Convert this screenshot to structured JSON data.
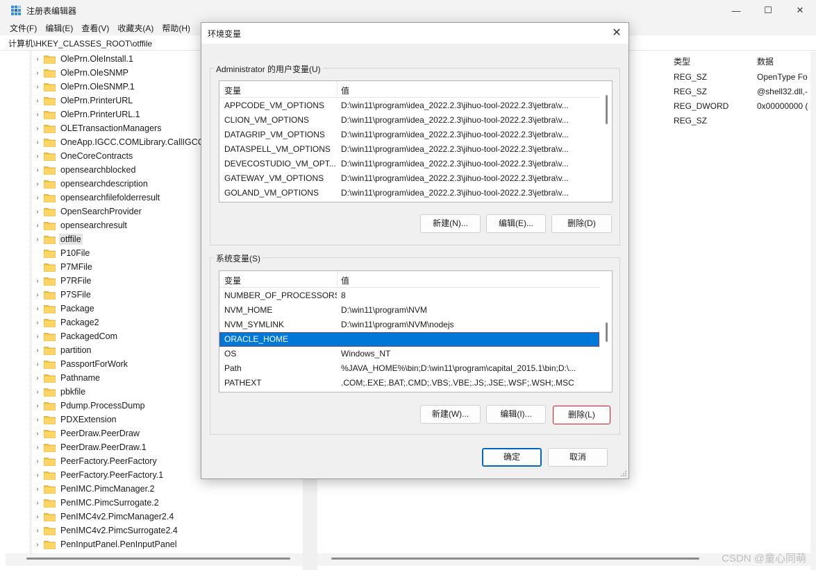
{
  "app": {
    "title": "注册表编辑器",
    "controls": {
      "minimize": "—",
      "maximize": "☐",
      "close": "✕"
    }
  },
  "menu": [
    "文件(F)",
    "编辑(E)",
    "查看(V)",
    "收藏夹(A)",
    "帮助(H)"
  ],
  "address": "计算机\\HKEY_CLASSES_ROOT\\otffile",
  "tree": [
    {
      "label": "OlePrn.OleInstall.1",
      "expandable": true
    },
    {
      "label": "OlePrn.OleSNMP",
      "expandable": true
    },
    {
      "label": "OlePrn.OleSNMP.1",
      "expandable": true
    },
    {
      "label": "OlePrn.PrinterURL",
      "expandable": true
    },
    {
      "label": "OlePrn.PrinterURL.1",
      "expandable": true
    },
    {
      "label": "OLETransactionManagers",
      "expandable": true
    },
    {
      "label": "OneApp.IGCC.COMLibrary.CallIGCC",
      "expandable": true
    },
    {
      "label": "OneCoreContracts",
      "expandable": true
    },
    {
      "label": "opensearchblocked",
      "expandable": true
    },
    {
      "label": "opensearchdescription",
      "expandable": true
    },
    {
      "label": "opensearchfilefolderresult",
      "expandable": true
    },
    {
      "label": "OpenSearchProvider",
      "expandable": true
    },
    {
      "label": "opensearchresult",
      "expandable": true
    },
    {
      "label": "otffile",
      "expandable": true,
      "selected": true
    },
    {
      "label": "P10File",
      "expandable": false
    },
    {
      "label": "P7MFile",
      "expandable": false
    },
    {
      "label": "P7RFile",
      "expandable": true
    },
    {
      "label": "P7SFile",
      "expandable": true
    },
    {
      "label": "Package",
      "expandable": true
    },
    {
      "label": "Package2",
      "expandable": true
    },
    {
      "label": "PackagedCom",
      "expandable": true
    },
    {
      "label": "partition",
      "expandable": true
    },
    {
      "label": "PassportForWork",
      "expandable": true
    },
    {
      "label": "Pathname",
      "expandable": true
    },
    {
      "label": "pbkfile",
      "expandable": true
    },
    {
      "label": "Pdump.ProcessDump",
      "expandable": true
    },
    {
      "label": "PDXExtension",
      "expandable": true
    },
    {
      "label": "PeerDraw.PeerDraw",
      "expandable": true
    },
    {
      "label": "PeerDraw.PeerDraw.1",
      "expandable": true
    },
    {
      "label": "PeerFactory.PeerFactory",
      "expandable": true
    },
    {
      "label": "PeerFactory.PeerFactory.1",
      "expandable": true
    },
    {
      "label": "PenIMC.PimcManager.2",
      "expandable": true
    },
    {
      "label": "PenIMC.PimcSurrogate.2",
      "expandable": true
    },
    {
      "label": "PenIMC4v2.PimcManager2.4",
      "expandable": true
    },
    {
      "label": "PenIMC4v2.PimcSurrogate2.4",
      "expandable": true
    },
    {
      "label": "PenInputPanel.PenInputPanel",
      "expandable": true
    }
  ],
  "values_pane": {
    "headers": {
      "type": "类型",
      "data": "数据"
    },
    "rows": [
      {
        "type": "REG_SZ",
        "data": "OpenType Fo"
      },
      {
        "type": "REG_SZ",
        "data": "@shell32.dll,-"
      },
      {
        "type": "REG_DWORD",
        "data": "0x00000000 ("
      },
      {
        "type": "REG_SZ",
        "data": ""
      }
    ]
  },
  "dialog": {
    "title": "环境变量",
    "close": "✕",
    "user_group": {
      "label": "Administrator 的用户变量(U)",
      "col_name": "变量",
      "col_value": "值",
      "rows": [
        {
          "name": "APPCODE_VM_OPTIONS",
          "value": "D:\\win11\\program\\idea_2022.2.3\\jihuo-tool-2022.2.3\\jetbra\\v..."
        },
        {
          "name": "CLION_VM_OPTIONS",
          "value": "D:\\win11\\program\\idea_2022.2.3\\jihuo-tool-2022.2.3\\jetbra\\v..."
        },
        {
          "name": "DATAGRIP_VM_OPTIONS",
          "value": "D:\\win11\\program\\idea_2022.2.3\\jihuo-tool-2022.2.3\\jetbra\\v..."
        },
        {
          "name": "DATASPELL_VM_OPTIONS",
          "value": "D:\\win11\\program\\idea_2022.2.3\\jihuo-tool-2022.2.3\\jetbra\\v..."
        },
        {
          "name": "DEVECOSTUDIO_VM_OPT...",
          "value": "D:\\win11\\program\\idea_2022.2.3\\jihuo-tool-2022.2.3\\jetbra\\v..."
        },
        {
          "name": "GATEWAY_VM_OPTIONS",
          "value": "D:\\win11\\program\\idea_2022.2.3\\jihuo-tool-2022.2.3\\jetbra\\v..."
        },
        {
          "name": "GOLAND_VM_OPTIONS",
          "value": "D:\\win11\\program\\idea_2022.2.3\\jihuo-tool-2022.2.3\\jetbra\\v..."
        }
      ],
      "buttons": {
        "new": "新建(N)...",
        "edit": "编辑(E)...",
        "delete": "删除(D)"
      }
    },
    "system_group": {
      "label": "系统变量(S)",
      "col_name": "变量",
      "col_value": "值",
      "rows": [
        {
          "name": "NUMBER_OF_PROCESSORS",
          "value": "8"
        },
        {
          "name": "NVM_HOME",
          "value": "D:\\win11\\program\\NVM"
        },
        {
          "name": "NVM_SYMLINK",
          "value": "D:\\win11\\program\\NVM\\nodejs"
        },
        {
          "name": "ORACLE_HOME",
          "value": "",
          "selected": true
        },
        {
          "name": "OS",
          "value": "Windows_NT"
        },
        {
          "name": "Path",
          "value": "%JAVA_HOME%\\bin;D:\\win11\\program\\capital_2015.1\\bin;D:\\..."
        },
        {
          "name": "PATHEXT",
          "value": ".COM;.EXE;.BAT;.CMD;.VBS;.VBE;.JS;.JSE;.WSF;.WSH;.MSC"
        }
      ],
      "buttons": {
        "new": "新建(W)...",
        "edit": "编辑(I)...",
        "delete": "删除(L)"
      }
    },
    "ok": "确定",
    "cancel": "取消"
  },
  "watermark": "CSDN @童心同萌"
}
